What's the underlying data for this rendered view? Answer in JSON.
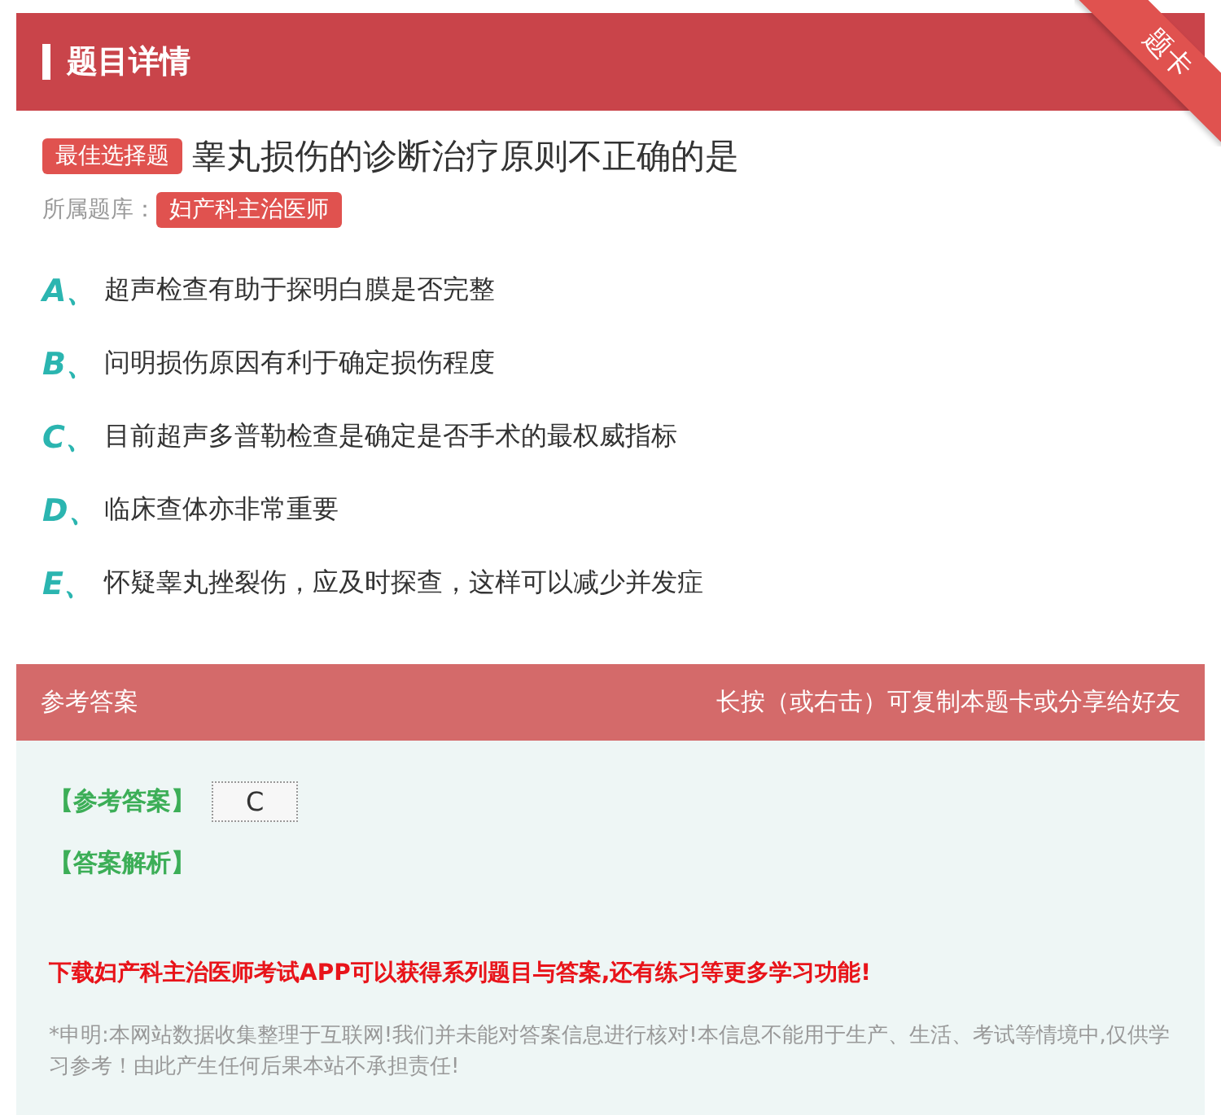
{
  "header": {
    "title": "题目详情",
    "ribbon": "题卡"
  },
  "question": {
    "type_badge": "最佳选择题",
    "text": "睾丸损伤的诊断治疗原则不正确的是",
    "library_label": "所属题库：",
    "library": "妇产科主治医师"
  },
  "options": [
    {
      "letter": "A、",
      "text": "超声检查有助于探明白膜是否完整"
    },
    {
      "letter": "B、",
      "text": "问明损伤原因有利于确定损伤程度"
    },
    {
      "letter": "C、",
      "text": "目前超声多普勒检查是确定是否手术的最权威指标"
    },
    {
      "letter": "D、",
      "text": "临床查体亦非常重要"
    },
    {
      "letter": "E、",
      "text": "怀疑睾丸挫裂伤，应及时探查，这样可以减少并发症"
    }
  ],
  "answer_section": {
    "title": "参考答案",
    "hint": "长按（或右击）可复制本题卡或分享给好友",
    "answer_label": "【参考答案】",
    "answer": "C",
    "analysis_label": "【答案解析】",
    "promo": "下载妇产科主治医师考试APP可以获得系列题目与答案,还有练习等更多学习功能!",
    "disclaimer": "*申明:本网站数据收集整理于互联网!我们并未能对答案信息进行核对!本信息不能用于生产、生活、考试等情境中,仅供学习参考！由此产生任何后果本站不承担责任!"
  }
}
